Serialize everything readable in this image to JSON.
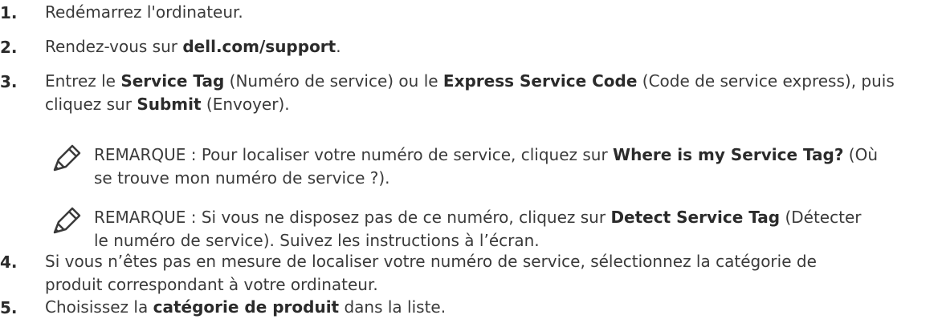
{
  "steps": [
    {
      "num": "1.",
      "lines": [
        [
          {
            "t": "Redémarrez l'ordinateur."
          }
        ]
      ]
    },
    {
      "num": "2.",
      "lines": [
        [
          {
            "t": "Rendez-vous sur "
          },
          {
            "t": "dell.com/support",
            "b": true
          },
          {
            "t": "."
          }
        ]
      ]
    },
    {
      "num": "3.",
      "lines": [
        [
          {
            "t": "Entrez le "
          },
          {
            "t": "Service Tag",
            "b": true
          },
          {
            "t": " (Numéro de service) ou le "
          },
          {
            "t": "Express Service Code",
            "b": true
          },
          {
            "t": " (Code de service express), puis"
          }
        ],
        [
          {
            "t": "cliquez sur "
          },
          {
            "t": "Submit",
            "b": true
          },
          {
            "t": " (Envoyer)."
          }
        ]
      ]
    },
    {
      "num": "4.",
      "lines": [
        [
          {
            "t": "Si vous n’êtes pas en mesure de localiser votre numéro de service, sélectionnez la catégorie de"
          }
        ],
        [
          {
            "t": "produit correspondant à votre ordinateur."
          }
        ]
      ]
    },
    {
      "num": "5.",
      "lines": [
        [
          {
            "t": "Choisissez la "
          },
          {
            "t": "catégorie de produit",
            "b": true
          },
          {
            "t": " dans la liste."
          }
        ]
      ]
    }
  ],
  "notes": [
    {
      "icon": "note-pencil-icon",
      "lines": [
        [
          {
            "t": "REMARQUE : Pour localiser votre numéro de service, cliquez sur "
          },
          {
            "t": "Where is my Service Tag?",
            "b": true
          },
          {
            "t": " (Où"
          }
        ],
        [
          {
            "t": "se trouve mon numéro de service ?)."
          }
        ]
      ]
    },
    {
      "icon": "note-pencil-icon",
      "lines": [
        [
          {
            "t": "REMARQUE : Si vous ne disposez pas de ce numéro, cliquez sur "
          },
          {
            "t": "Detect Service Tag",
            "b": true
          },
          {
            "t": " (Détecter"
          }
        ],
        [
          {
            "t": "le numéro de service). Suivez les instructions à l’écran."
          }
        ]
      ]
    }
  ]
}
